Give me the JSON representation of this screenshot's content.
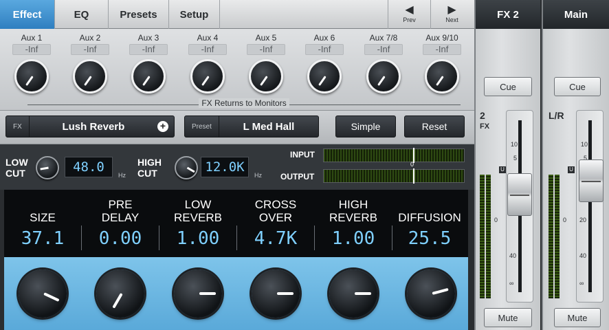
{
  "tabs": [
    {
      "label": "Effect",
      "active": true
    },
    {
      "label": "EQ",
      "active": false
    },
    {
      "label": "Presets",
      "active": false
    },
    {
      "label": "Setup",
      "active": false
    }
  ],
  "nav": {
    "prev_label": "Prev",
    "next_label": "Next",
    "prev_icon": "arrow-left-icon",
    "next_icon": "arrow-right-icon"
  },
  "aux_sends": [
    {
      "name": "Aux 1",
      "value": "-Inf"
    },
    {
      "name": "Aux 2",
      "value": "-Inf"
    },
    {
      "name": "Aux 3",
      "value": "-Inf"
    },
    {
      "name": "Aux 4",
      "value": "-Inf"
    },
    {
      "name": "Aux 5",
      "value": "-Inf"
    },
    {
      "name": "Aux 6",
      "value": "-Inf"
    },
    {
      "name": "Aux 7/8",
      "value": "-Inf"
    },
    {
      "name": "Aux 9/10",
      "value": "-Inf"
    }
  ],
  "fx_returns_label": "FX Returns to Monitors",
  "fx_selector": {
    "tag": "FX",
    "name": "Lush Reverb",
    "add_icon": "plus-circle-icon"
  },
  "preset_selector": {
    "tag": "Preset",
    "name": "L Med Hall"
  },
  "buttons": {
    "simple": "Simple",
    "reset": "Reset"
  },
  "low_cut": {
    "label_line1": "LOW",
    "label_line2": "CUT",
    "value": "48.0",
    "unit": "Hz"
  },
  "high_cut": {
    "label_line1": "HIGH",
    "label_line2": "CUT",
    "value": "12.0K",
    "unit": "Hz"
  },
  "meters": {
    "input_label": "INPUT",
    "output_label": "OUTPUT",
    "zero_label": "0"
  },
  "params": [
    {
      "line1": "",
      "line2": "SIZE",
      "value": "37.1"
    },
    {
      "line1": "PRE",
      "line2": "DELAY",
      "value": "0.00"
    },
    {
      "line1": "LOW",
      "line2": "REVERB",
      "value": "1.00"
    },
    {
      "line1": "CROSS",
      "line2": "OVER",
      "value": "4.7K"
    },
    {
      "line1": "HIGH",
      "line2": "REVERB",
      "value": "1.00"
    },
    {
      "line1": "",
      "line2": "DIFFUSION",
      "value": "25.5"
    }
  ],
  "strips": {
    "fx2": {
      "title": "FX 2",
      "cue": "Cue",
      "mute": "Mute",
      "label_line1": "2",
      "label_line2": "FX",
      "unity": "U"
    },
    "main": {
      "title": "Main",
      "cue": "Cue",
      "mute": "Mute",
      "label_line1": "L/R",
      "unity": "U"
    },
    "scale": [
      "10",
      "5",
      "0",
      "20",
      "40",
      "∞"
    ]
  }
}
